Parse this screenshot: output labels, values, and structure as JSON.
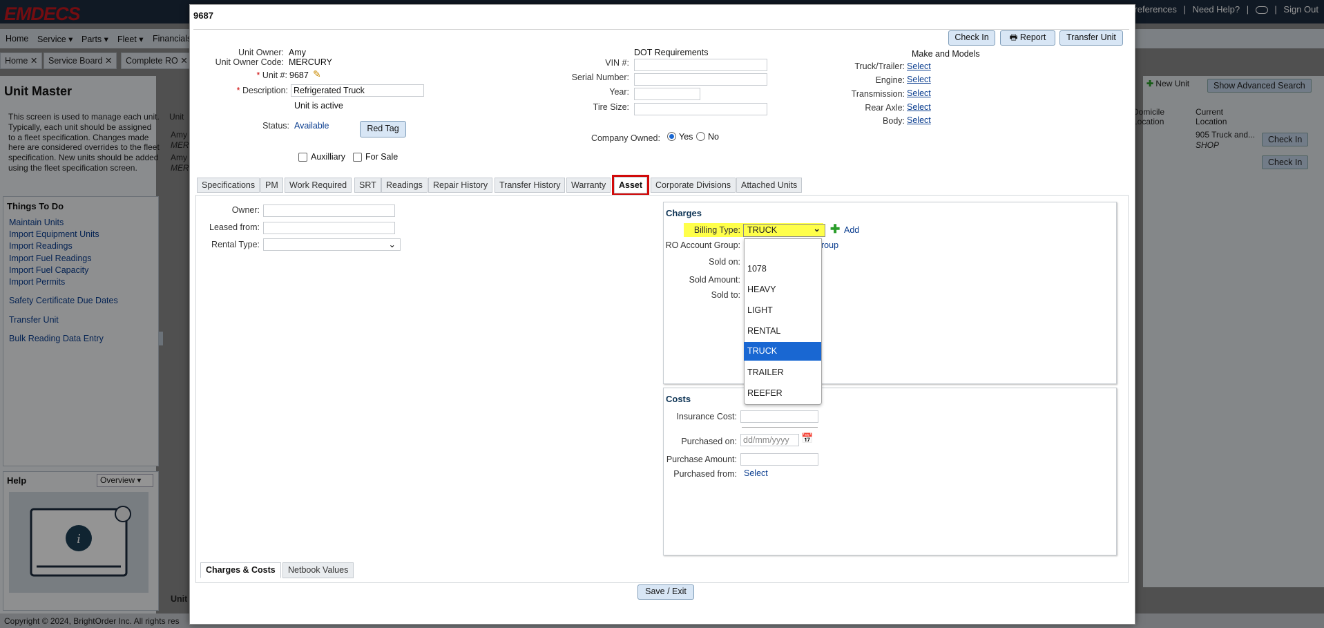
{
  "app": {
    "logo": "EMDECS",
    "top_links": [
      "Preferences",
      "|",
      "Need Help?",
      "|",
      "|",
      "Sign Out"
    ],
    "nav": [
      "Home",
      "Service",
      "Parts",
      "Fleet",
      "Financials"
    ],
    "tabs": [
      "Home",
      "Service Board",
      "Complete RO"
    ],
    "page_title": "Unit Master",
    "page_desc": "This screen is used to manage each unit. Typically, each unit should be assigned to a fleet specification. Changes made here are considered overrides to the fleet specification. New units should be added using the fleet specification screen.",
    "todo_title": "Things To Do",
    "todo_links": [
      "Maintain Units",
      "Import Equipment Units",
      "Import Readings",
      "Import Fuel Readings",
      "Import Fuel Capacity",
      "Import Permits",
      "Safety Certificate Due Dates",
      "Transfer Unit",
      "Bulk Reading Data Entry"
    ],
    "help_title": "Help",
    "help_select": "Overview",
    "new_unit": "New Unit",
    "show_advanced": "Show Advanced Search",
    "grid_headers": [
      "Unit",
      "Domicile Location",
      "Current Location"
    ],
    "grid_rows": [
      {
        "owner": "Amy",
        "code": "MER",
        "current": "905 Truck and...",
        "current2": "SHOP",
        "action": "Check In"
      },
      {
        "owner": "Amy",
        "code": "MER",
        "current": "",
        "current2": "",
        "action": "Check In"
      }
    ],
    "bottom_label": "Unit",
    "footer": "Copyright © 2024, BrightOrder Inc. All rights res"
  },
  "modal": {
    "title": "9687",
    "buttons": {
      "check_in": "Check In",
      "report": "Report",
      "transfer": "Transfer Unit"
    },
    "unit_owner_label": "Unit Owner:",
    "unit_owner": "Amy",
    "unit_owner_code_label": "Unit Owner Code:",
    "unit_owner_code": "MERCURY",
    "unit_num_label": "Unit #:",
    "unit_num": "9687",
    "description_label": "Description:",
    "description": "Refrigerated Truck",
    "active_text": "Unit is active",
    "status_label": "Status:",
    "status": "Available",
    "red_tag": "Red Tag",
    "auxilliary": "Auxilliary",
    "for_sale": "For Sale",
    "dot_title": "DOT Requirements",
    "vin_label": "VIN #:",
    "serial_label": "Serial Number:",
    "year_label": "Year:",
    "tire_label": "Tire Size:",
    "company_owned_label": "Company Owned:",
    "yes": "Yes",
    "no": "No",
    "make_title": "Make and Models",
    "make_rows": [
      {
        "label": "Truck/Trailer:",
        "link": "Select"
      },
      {
        "label": "Engine:",
        "link": "Select"
      },
      {
        "label": "Transmission:",
        "link": "Select"
      },
      {
        "label": "Rear Axle:",
        "link": "Select"
      },
      {
        "label": "Body:",
        "link": "Select"
      }
    ],
    "tabs": [
      "Specifications",
      "PM",
      "Work Required",
      "SRT",
      "Readings",
      "Repair History",
      "Transfer History",
      "Warranty",
      "Asset",
      "Corporate Divisions",
      "Attached Units"
    ],
    "active_tab": "Asset",
    "owner_label": "Owner:",
    "leased_label": "Leased from:",
    "rental_label": "Rental Type:",
    "charges_title": "Charges",
    "billing_label": "Billing Type:",
    "billing_value": "TRUCK",
    "add_label": "Add",
    "ro_group_label": "RO Account Group:",
    "ro_group_link": "roup",
    "sold_on_label": "Sold on:",
    "sold_amount_label": "Sold Amount:",
    "sold_to_label": "Sold to:",
    "billing_options": [
      "",
      "1078",
      "HEAVY",
      "LIGHT",
      "RENTAL",
      "TRUCK",
      "TRAILER",
      "REEFER"
    ],
    "billing_selected": "TRUCK",
    "costs_title": "Costs",
    "insurance_label": "Insurance Cost:",
    "purchased_on_label": "Purchased on:",
    "purchased_on_placeholder": "dd/mm/yyyy",
    "purchase_amount_label": "Purchase Amount:",
    "purchased_from_label": "Purchased from:",
    "purchased_from_link": "Select",
    "bottom_tabs": [
      "Charges & Costs",
      "Netbook Values"
    ],
    "save_exit": "Save / Exit"
  },
  "colors": {
    "topbar": "#1c2b3f",
    "logo": "#c8171e",
    "highlight": "#ffff4a",
    "selected_option": "#1967d2",
    "asset_tab_outline": "#d10a0a"
  }
}
